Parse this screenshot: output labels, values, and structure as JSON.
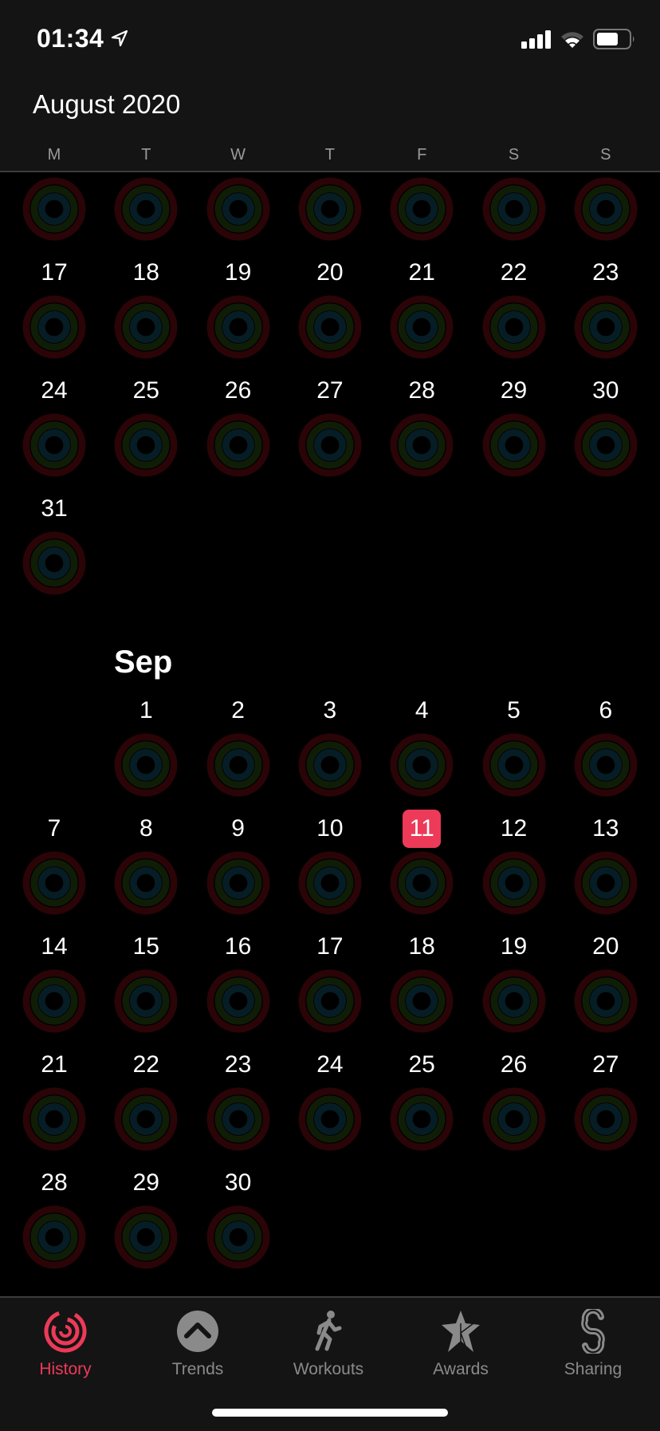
{
  "status_bar": {
    "time": "01:34",
    "location_icon": "location-arrow-icon",
    "signal_icon": "cellular-signal-icon",
    "wifi_icon": "wifi-icon",
    "battery_icon": "battery-icon"
  },
  "header": {
    "month_title": "August 2020",
    "weekdays": [
      "M",
      "T",
      "W",
      "T",
      "F",
      "S",
      "S"
    ]
  },
  "colors": {
    "accent": "#ec3a58",
    "ring_move": "#2a0407",
    "ring_exercise": "#0f1d07",
    "ring_stand": "#061d26"
  },
  "august": {
    "rows": [
      {
        "label_row": false,
        "days": [
          "",
          "",
          "",
          "",
          "",
          "",
          ""
        ],
        "rings": [
          true,
          true,
          true,
          true,
          true,
          true,
          true
        ]
      },
      {
        "days": [
          "17",
          "18",
          "19",
          "20",
          "21",
          "22",
          "23"
        ],
        "rings": [
          true,
          true,
          true,
          true,
          true,
          true,
          true
        ]
      },
      {
        "days": [
          "24",
          "25",
          "26",
          "27",
          "28",
          "29",
          "30"
        ],
        "rings": [
          true,
          true,
          true,
          true,
          true,
          true,
          true
        ]
      },
      {
        "days": [
          "31",
          "",
          "",
          "",
          "",
          "",
          ""
        ],
        "rings": [
          true,
          false,
          false,
          false,
          false,
          false,
          false
        ]
      }
    ]
  },
  "september": {
    "label": "Sep",
    "today": "11",
    "rows": [
      {
        "days": [
          "",
          "1",
          "2",
          "3",
          "4",
          "5",
          "6"
        ]
      },
      {
        "days": [
          "7",
          "8",
          "9",
          "10",
          "11",
          "12",
          "13"
        ]
      },
      {
        "days": [
          "14",
          "15",
          "16",
          "17",
          "18",
          "19",
          "20"
        ]
      },
      {
        "days": [
          "21",
          "22",
          "23",
          "24",
          "25",
          "26",
          "27"
        ]
      },
      {
        "days": [
          "28",
          "29",
          "30",
          "",
          "",
          "",
          ""
        ]
      }
    ]
  },
  "tabbar": {
    "tabs": [
      {
        "label": "History",
        "icon": "history-rings-icon",
        "active": true
      },
      {
        "label": "Trends",
        "icon": "trends-chevron-icon",
        "active": false
      },
      {
        "label": "Workouts",
        "icon": "running-figure-icon",
        "active": false
      },
      {
        "label": "Awards",
        "icon": "award-star-icon",
        "active": false
      },
      {
        "label": "Sharing",
        "icon": "sharing-s-icon",
        "active": false
      }
    ]
  }
}
